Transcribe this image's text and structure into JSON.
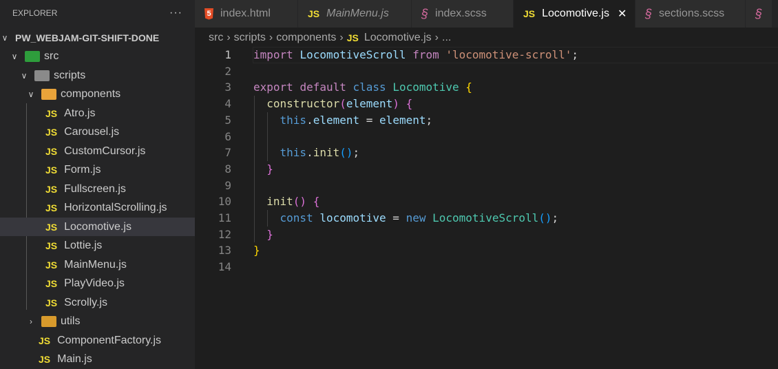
{
  "sidebar": {
    "title": "EXPLORER",
    "more": "···",
    "root": "PW_WEBJAM-GIT-SHIFT-DONE",
    "folders": {
      "src": "src",
      "scripts": "scripts",
      "components": "components",
      "utils": "utils"
    },
    "components": [
      "Atro.js",
      "Carousel.js",
      "CustomCursor.js",
      "Form.js",
      "Fullscreen.js",
      "HorizontalScrolling.js",
      "Locomotive.js",
      "Lottie.js",
      "MainMenu.js",
      "PlayVideo.js",
      "Scrolly.js"
    ],
    "scripts_files": [
      "ComponentFactory.js",
      "Main.js"
    ],
    "selected": "Locomotive.js",
    "js_badge": "JS"
  },
  "tabs": [
    {
      "label": "index.html",
      "icon": "html5-icon"
    },
    {
      "label": "MainMenu.js",
      "icon": "js-icon",
      "preview": true
    },
    {
      "label": "index.scss",
      "icon": "sass-icon"
    },
    {
      "label": "Locomotive.js",
      "icon": "js-icon",
      "active": true
    },
    {
      "label": "sections.scss",
      "icon": "sass-icon"
    }
  ],
  "breadcrumb": [
    "src",
    "scripts",
    "components",
    "Locomotive.js",
    "..."
  ],
  "editor": {
    "current_line": 1,
    "lines": [
      [
        [
          "kw",
          "import"
        ],
        [
          "pl",
          " "
        ],
        [
          "var",
          "LocomotiveScroll"
        ],
        [
          "pl",
          " "
        ],
        [
          "kw",
          "from"
        ],
        [
          "pl",
          " "
        ],
        [
          "str",
          "'locomotive-scroll'"
        ],
        [
          "pl",
          ";"
        ]
      ],
      [],
      [
        [
          "kw",
          "export"
        ],
        [
          "pl",
          " "
        ],
        [
          "kw",
          "default"
        ],
        [
          "pl",
          " "
        ],
        [
          "st",
          "class"
        ],
        [
          "pl",
          " "
        ],
        [
          "cls",
          "Locomotive"
        ],
        [
          "pl",
          " "
        ],
        [
          "b1",
          "{"
        ]
      ],
      [
        [
          "pl",
          "  "
        ],
        [
          "fn",
          "constructor"
        ],
        [
          "b2",
          "("
        ],
        [
          "var",
          "element"
        ],
        [
          "b2",
          ")"
        ],
        [
          "pl",
          " "
        ],
        [
          "b2",
          "{"
        ]
      ],
      [
        [
          "pl",
          "    "
        ],
        [
          "st",
          "this"
        ],
        [
          "pl",
          "."
        ],
        [
          "var",
          "element"
        ],
        [
          "pl",
          " = "
        ],
        [
          "var",
          "element"
        ],
        [
          "pl",
          ";"
        ]
      ],
      [],
      [
        [
          "pl",
          "    "
        ],
        [
          "st",
          "this"
        ],
        [
          "pl",
          "."
        ],
        [
          "fn",
          "init"
        ],
        [
          "b3",
          "()"
        ],
        [
          "pl",
          ";"
        ]
      ],
      [
        [
          "pl",
          "  "
        ],
        [
          "b2",
          "}"
        ]
      ],
      [],
      [
        [
          "pl",
          "  "
        ],
        [
          "fn",
          "init"
        ],
        [
          "b2",
          "()"
        ],
        [
          "pl",
          " "
        ],
        [
          "b2",
          "{"
        ]
      ],
      [
        [
          "pl",
          "    "
        ],
        [
          "st",
          "const"
        ],
        [
          "pl",
          " "
        ],
        [
          "var",
          "locomotive"
        ],
        [
          "pl",
          " = "
        ],
        [
          "st",
          "new"
        ],
        [
          "pl",
          " "
        ],
        [
          "cls",
          "LocomotiveScroll"
        ],
        [
          "b3",
          "()"
        ],
        [
          "pl",
          ";"
        ]
      ],
      [
        [
          "pl",
          "  "
        ],
        [
          "b2",
          "}"
        ]
      ],
      [
        [
          "b1",
          "}"
        ]
      ],
      []
    ]
  }
}
